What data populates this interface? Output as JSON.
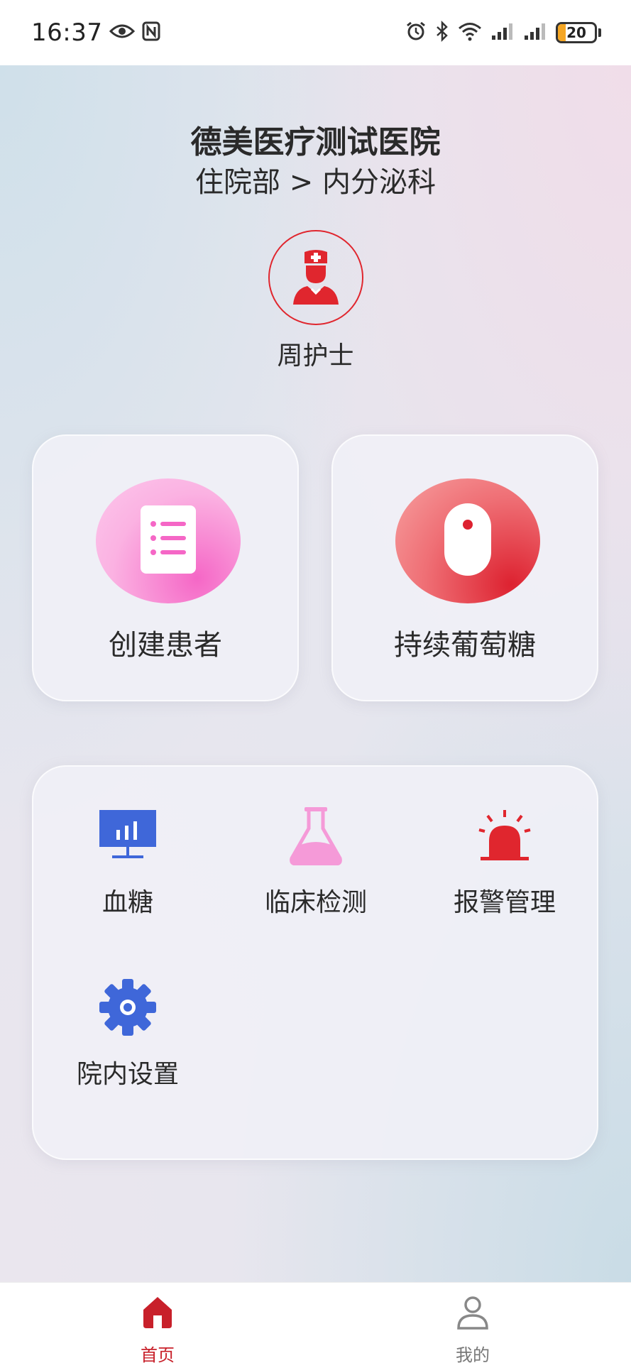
{
  "status_bar": {
    "time": "16:37",
    "battery_level": "20",
    "icons": [
      "eye-icon",
      "nfc-icon",
      "alarm-icon",
      "bluetooth-icon",
      "wifi-icon",
      "signal-icon",
      "signal-icon",
      "battery-icon"
    ]
  },
  "header": {
    "hospital_name": "德美医疗测试医院",
    "department_path": "住院部 > 内分泌科"
  },
  "user": {
    "name": "周护士",
    "avatar_icon": "nurse-icon"
  },
  "main_cards": [
    {
      "label": "创建患者",
      "icon": "patient-list-icon",
      "color": "#f567c6"
    },
    {
      "label": "持续葡萄糖",
      "icon": "cgm-sensor-icon",
      "color": "#dd2230"
    }
  ],
  "menu": [
    {
      "label": "血糖",
      "icon": "monitor-chart-icon",
      "color": "#3f67d9"
    },
    {
      "label": "临床检测",
      "icon": "flask-icon",
      "color": "#f59ad8"
    },
    {
      "label": "报警管理",
      "icon": "alarm-light-icon",
      "color": "#e0262e"
    },
    {
      "label": "院内设置",
      "icon": "gear-icon",
      "color": "#3f67d9"
    }
  ],
  "bottom_nav": [
    {
      "label": "首页",
      "icon": "home-icon",
      "active": true
    },
    {
      "label": "我的",
      "icon": "user-icon",
      "active": false
    }
  ],
  "colors": {
    "accent": "#c8202a",
    "text": "#2a2a2a"
  }
}
